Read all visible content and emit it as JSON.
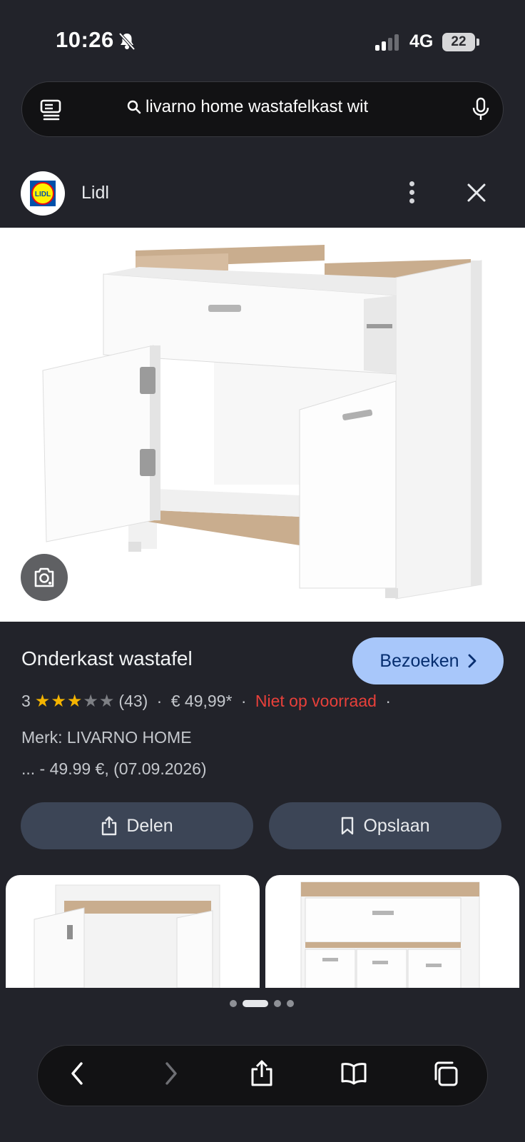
{
  "status": {
    "time": "10:26",
    "network": "4G",
    "battery": "22"
  },
  "search": {
    "query": "livarno home wastafelkast wit"
  },
  "source": {
    "name": "Lidl",
    "logo_text": "LIDL"
  },
  "product": {
    "title": "Onderkast wastafel",
    "visit_label": "Bezoeken",
    "rating": "3",
    "rating_stars": 3,
    "rating_max": 5,
    "reviews": "(43)",
    "price": "€ 49,99*",
    "stock": "Niet op voorraad",
    "brand": "Merk: LIVARNO HOME",
    "price_detail": "... - 49.99 €, (07.09.2026)"
  },
  "actions": {
    "share_label": "Delen",
    "save_label": "Opslaan"
  },
  "carousel": {
    "pages": 4,
    "active": 2
  },
  "colors": {
    "accent": "#a8c7fa",
    "stock_red": "#e8403a",
    "star": "#f5b400"
  }
}
